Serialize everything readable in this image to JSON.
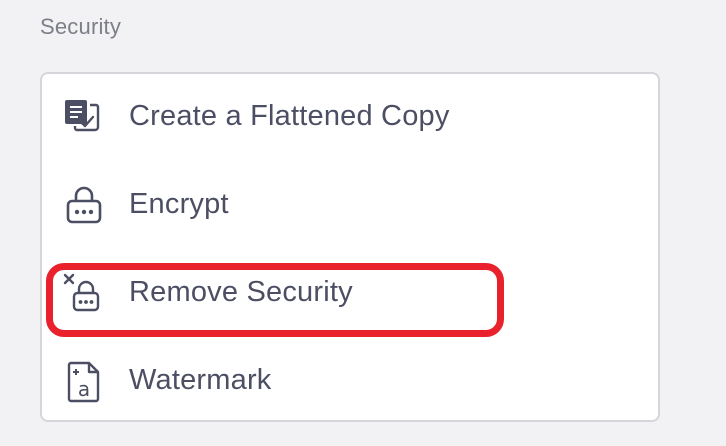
{
  "section": {
    "title": "Security"
  },
  "menu": {
    "items": [
      {
        "label": "Create a Flattened Copy",
        "icon": "flattened-copy-icon"
      },
      {
        "label": "Encrypt",
        "icon": "lock-icon"
      },
      {
        "label": "Remove Security",
        "icon": "unlock-remove-icon",
        "highlighted": true
      },
      {
        "label": "Watermark",
        "icon": "watermark-icon"
      }
    ]
  },
  "colors": {
    "highlight": "#e8212d",
    "text": "#4c4f63",
    "icon": "#4c4f63",
    "section_label": "#7d7f88"
  }
}
